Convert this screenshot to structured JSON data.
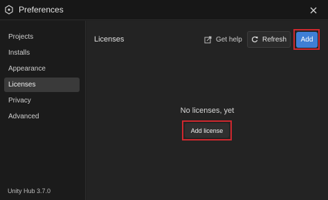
{
  "window": {
    "title": "Preferences",
    "icons": {
      "app": "unity-cube-icon",
      "close": "close-icon"
    }
  },
  "sidebar": {
    "items": [
      {
        "label": "Projects",
        "active": false
      },
      {
        "label": "Installs",
        "active": false
      },
      {
        "label": "Appearance",
        "active": false
      },
      {
        "label": "Licenses",
        "active": true
      },
      {
        "label": "Privacy",
        "active": false
      },
      {
        "label": "Advanced",
        "active": false
      }
    ],
    "version": "Unity Hub 3.7.0"
  },
  "main": {
    "title": "Licenses",
    "get_help_label": "Get help",
    "refresh_label": "Refresh",
    "add_label": "Add",
    "empty_text": "No licenses, yet",
    "add_license_label": "Add license",
    "icons": {
      "get_help": "external-link-icon",
      "refresh": "refresh-icon"
    }
  },
  "colors": {
    "accent": "#3f7fd6",
    "highlight_outline": "#d0282e",
    "active_nav_bg": "#3a3a3a",
    "background": "#232323"
  }
}
